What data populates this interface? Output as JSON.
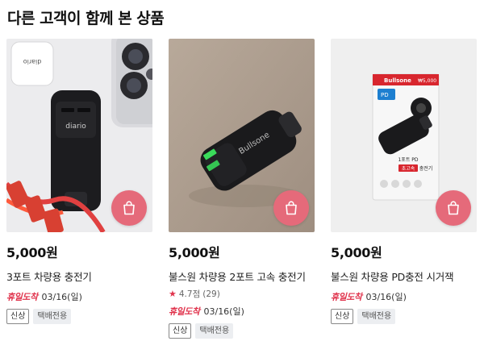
{
  "section": {
    "title": "다른 고객이 함께 본 상품"
  },
  "products": [
    {
      "price": "5,000원",
      "name": "3포트 차량용 충전기",
      "brand_text": "diario",
      "delivery_tag": "휴일도착",
      "delivery_date": "03/16(일)",
      "badge_new": "신상",
      "badge_parcel": "택배전용"
    },
    {
      "price": "5,000원",
      "name": "불스원 차량용 2포트 고속 충전기",
      "brand_text": "Bullsone",
      "rating_star": "★",
      "rating_score": "4.7점",
      "rating_count": "(29)",
      "delivery_tag": "휴일도착",
      "delivery_date": "03/16(일)",
      "badge_new": "신상",
      "badge_parcel": "택배전용"
    },
    {
      "price": "5,000원",
      "name": "불스원 차량용 PD충전 시거잭",
      "brand_text": "Bullsone",
      "package_price": "₩5,000",
      "package_label": "1포트 PD",
      "package_badge": "초고속",
      "package_sub": "충전기",
      "delivery_tag": "휴일도착",
      "delivery_date": "03/16(일)",
      "badge_new": "신상",
      "badge_parcel": "택배전용"
    }
  ],
  "icons": {
    "cart": "shopping-bag-icon",
    "star": "star-icon"
  },
  "colors": {
    "accent": "#e0334c",
    "cart_button": "#e56a7a",
    "badge_bg": "#eceef1"
  }
}
